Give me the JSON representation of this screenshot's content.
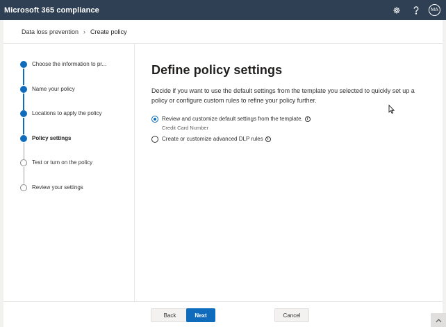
{
  "app": {
    "title": "Microsoft 365 compliance",
    "user_initials": "MA"
  },
  "icons": {
    "settings": "gear-icon",
    "help": "question-icon",
    "breadcrumb_separator": "chevron-right-icon",
    "scroll": "chevron-up-icon"
  },
  "breadcrumb": {
    "parent": "Data loss prevention",
    "current": "Create policy"
  },
  "steps": [
    {
      "label": "Choose the information to pr...",
      "state": "done"
    },
    {
      "label": "Name your policy",
      "state": "done"
    },
    {
      "label": "Locations to apply the policy",
      "state": "done"
    },
    {
      "label": "Policy settings",
      "state": "current"
    },
    {
      "label": "Test or turn on the policy",
      "state": "todo"
    },
    {
      "label": "Review your settings",
      "state": "todo"
    }
  ],
  "main": {
    "title": "Define policy settings",
    "description": "Decide if you want to use the default settings from the template you selected to quickly set up a policy or configure custom rules to refine your policy further.",
    "options": [
      {
        "label": "Review and customize default settings from the template.",
        "sublabel": "Credit Card Number",
        "selected": true
      },
      {
        "label": "Create or customize advanced DLP rules",
        "selected": false
      }
    ]
  },
  "footer": {
    "back": "Back",
    "next": "Next",
    "cancel": "Cancel"
  },
  "colors": {
    "topbar": "#2f4054",
    "accent": "#0f6cbd"
  }
}
